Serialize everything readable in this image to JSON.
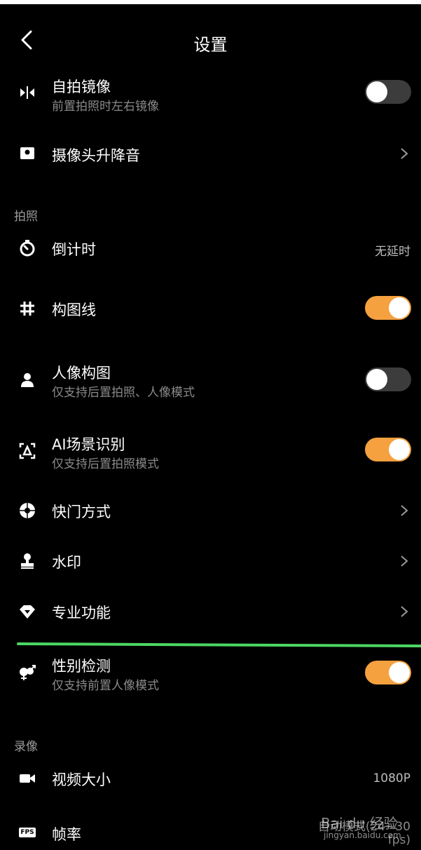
{
  "header": {
    "title": "设置"
  },
  "rows": {
    "mirror": {
      "label": "自拍镜像",
      "sub": "前置拍照时左右镜像",
      "state": "off",
      "icon": "mirror-icon"
    },
    "camera_sound": {
      "label": "摄像头升降音",
      "icon": "camera-popup-icon"
    },
    "timer": {
      "label": "倒计时",
      "value": "无延时",
      "icon": "timer-icon"
    },
    "grid": {
      "label": "构图线",
      "state": "on",
      "icon": "grid-icon"
    },
    "portrait_comp": {
      "label": "人像构图",
      "sub": "仅支持后置拍照、人像模式",
      "state": "off",
      "icon": "person-icon"
    },
    "ai_scene": {
      "label": "AI场景识别",
      "sub": "仅支持后置拍照模式",
      "state": "on",
      "icon": "ai-scene-icon"
    },
    "shutter": {
      "label": "快门方式",
      "icon": "shutter-icon"
    },
    "watermark": {
      "label": "水印",
      "icon": "stamp-icon"
    },
    "pro": {
      "label": "专业功能",
      "icon": "diamond-icon"
    },
    "gender": {
      "label": "性别检测",
      "sub": "仅支持前置人像模式",
      "state": "on",
      "icon": "gender-icon"
    },
    "video_size": {
      "label": "视频大小",
      "value": "1080P",
      "icon": "video-icon"
    },
    "frame_rate": {
      "label": "帧率",
      "value": "自动模式(24~30",
      "value2": "fps)",
      "icon": "fps-icon",
      "icon_text": "FPS"
    }
  },
  "sections": {
    "photo": "拍照",
    "video": "录像"
  },
  "overlay": {
    "watermark_text": "Bai du 经验",
    "watermark_url": "jingyan.baidu.com"
  },
  "colors": {
    "accent": "#f5a13f",
    "green_line": "#4cd763",
    "background": "#000000"
  }
}
